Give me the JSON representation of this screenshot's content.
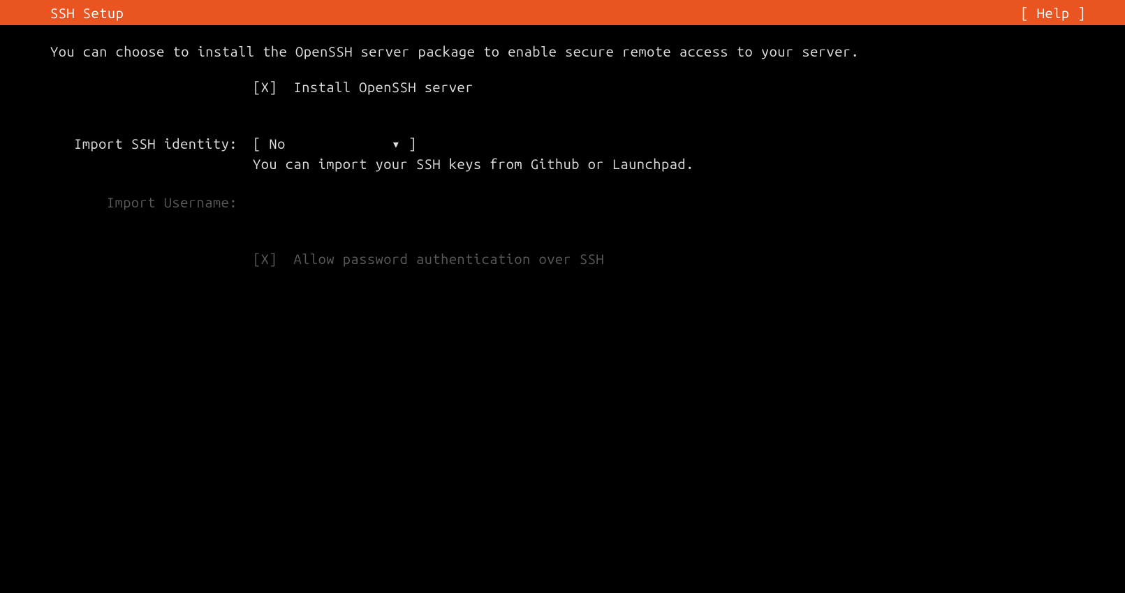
{
  "header": {
    "title": "SSH Setup",
    "help_label": "[ Help ]"
  },
  "main": {
    "description": "You can choose to install the OpenSSH server package to enable secure remote access to your server.",
    "install_checkbox": {
      "mark": "[X]",
      "label": "Install OpenSSH server"
    },
    "import_identity": {
      "label": "Import SSH identity:",
      "dropdown": "[ No             ▾ ]",
      "hint": "You can import your SSH keys from Github or Launchpad."
    },
    "import_username": {
      "label": "Import Username:"
    },
    "allow_password": {
      "mark": "[X]",
      "label": "Allow password authentication over SSH"
    }
  }
}
